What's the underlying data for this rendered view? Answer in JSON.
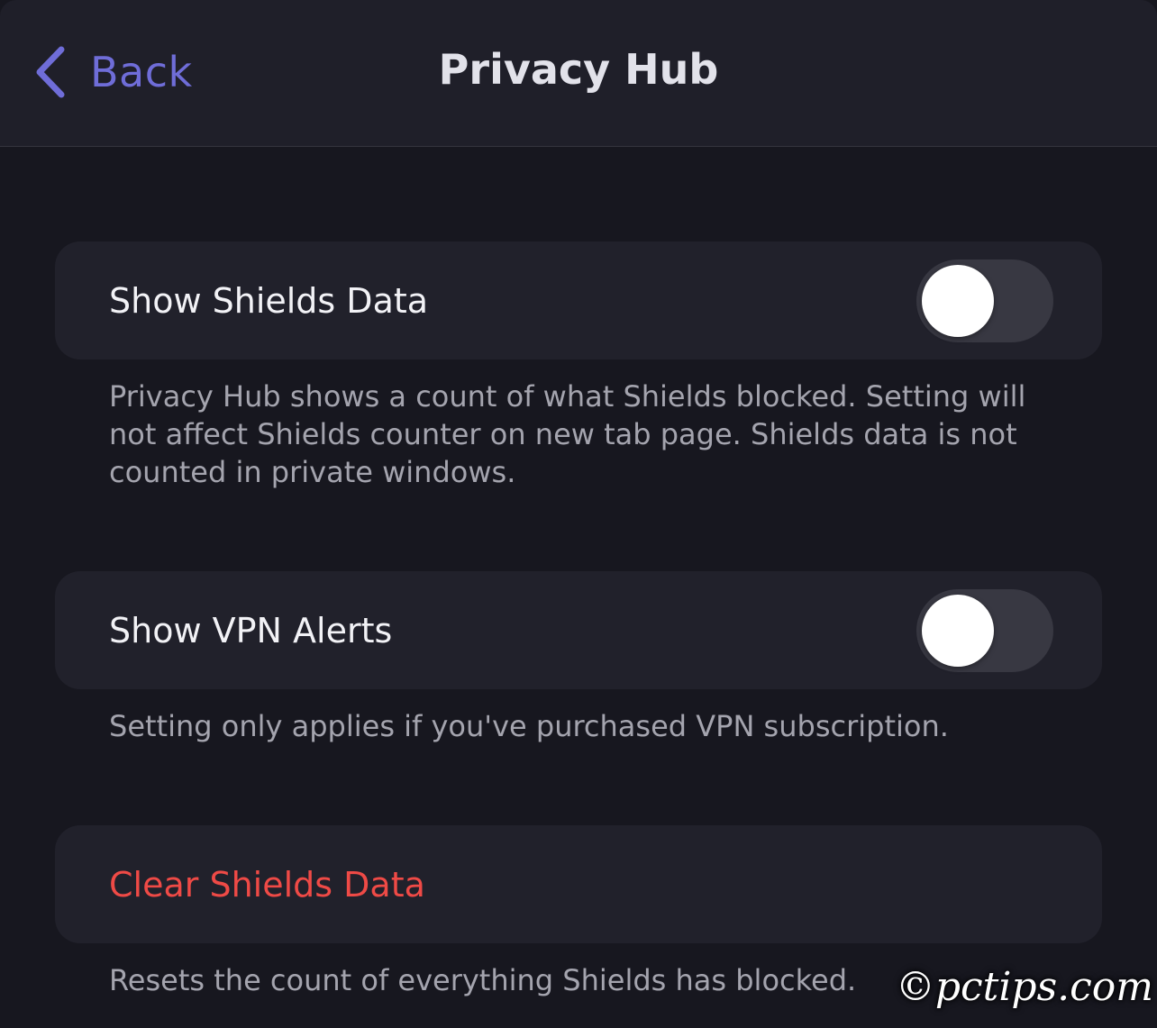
{
  "navbar": {
    "back_label": "Back",
    "title": "Privacy Hub",
    "back_icon": "chevron-left-icon",
    "accent_color": "#6f6dd8"
  },
  "settings": [
    {
      "label": "Show Shields Data",
      "toggle_on": false,
      "footer": "Privacy Hub shows a count of what Shields blocked. Setting will not affect Shields counter on new tab page. Shields data is not counted in private windows."
    },
    {
      "label": "Show VPN Alerts",
      "toggle_on": false,
      "footer": "Setting only applies if you've purchased VPN subscription."
    }
  ],
  "clear_action": {
    "label": "Clear Shields Data",
    "color": "#ef4a46",
    "footer": "Resets the count of everything Shields has blocked."
  },
  "watermark": "©pctips.com"
}
